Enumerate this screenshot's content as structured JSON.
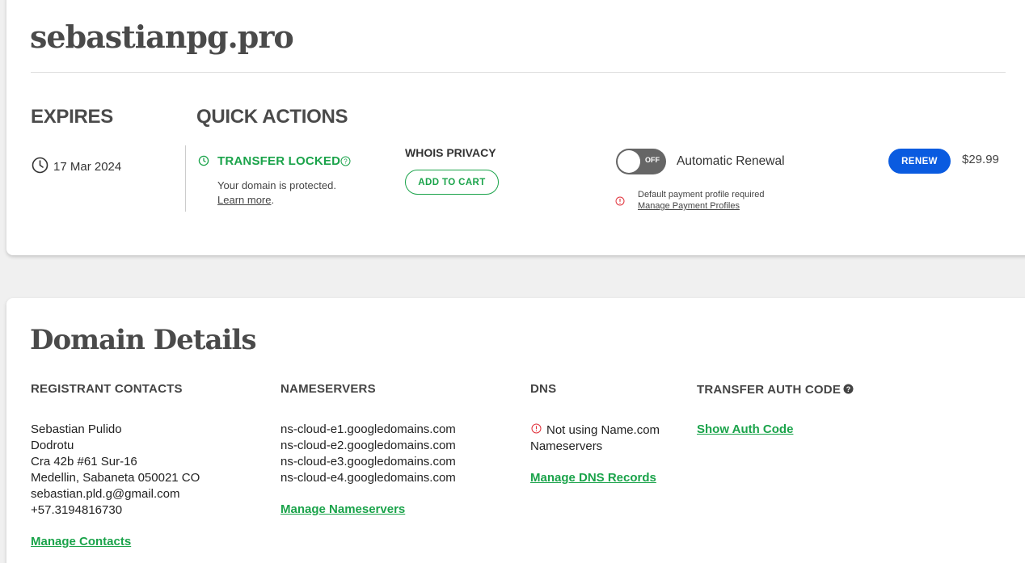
{
  "domain": {
    "name": "sebastianpg.pro"
  },
  "expires": {
    "heading": "EXPIRES",
    "date": "17 Mar 2024"
  },
  "quick_actions": {
    "heading": "QUICK ACTIONS",
    "transfer": {
      "status": "TRANSFER LOCKED",
      "desc": "Your domain is protected.",
      "learn_more": "Learn more",
      "learn_more_suffix": "."
    },
    "whois": {
      "heading": "WHOIS PRIVACY",
      "button": "ADD TO CART"
    },
    "renewal": {
      "toggle_state": "OFF",
      "label": "Automatic Renewal",
      "warning": "Default payment profile required",
      "manage_link": "Manage Payment Profiles"
    },
    "renew": {
      "button": "RENEW",
      "price": "$29.99"
    }
  },
  "details": {
    "title": "Domain Details",
    "registrant": {
      "heading": "REGISTRANT CONTACTS",
      "lines": [
        "Sebastian Pulido",
        "Dodrotu",
        "Cra 42b #61 Sur-16",
        "Medellin, Sabaneta 050021 CO",
        "sebastian.pld.g@gmail.com",
        "+57.3194816730"
      ],
      "manage": "Manage Contacts"
    },
    "nameservers": {
      "heading": "NAMESERVERS",
      "list": [
        "ns-cloud-e1.googledomains.com",
        "ns-cloud-e2.googledomains.com",
        "ns-cloud-e3.googledomains.com",
        "ns-cloud-e4.googledomains.com"
      ],
      "manage": "Manage Nameservers"
    },
    "dns": {
      "heading": "DNS",
      "status_line1": "Not using Name.com",
      "status_line2": "Nameservers",
      "manage": "Manage DNS Records"
    },
    "auth": {
      "heading": "TRANSFER AUTH CODE",
      "show": "Show Auth Code"
    }
  },
  "colors": {
    "green": "#1aa34a",
    "blue": "#0a5be0",
    "warning_red": "#e0303a",
    "toggle_off": "#666666"
  },
  "icons": {
    "clock": "clock-icon",
    "lock_clock": "transfer-clock-icon",
    "help": "help-icon",
    "warning": "warning-icon"
  }
}
